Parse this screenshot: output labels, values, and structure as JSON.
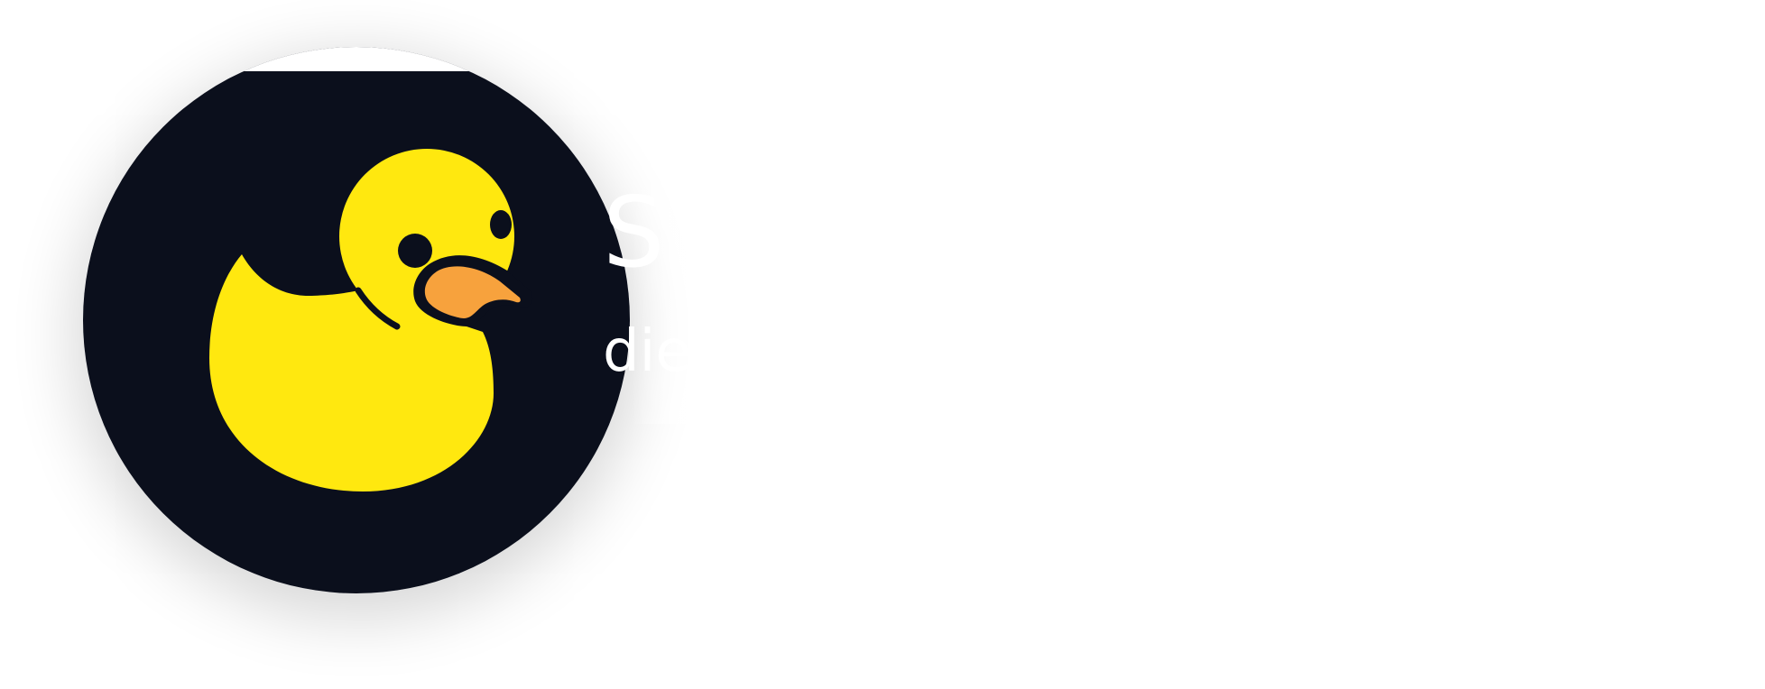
{
  "logo": {
    "icon": "rubber-duck-icon",
    "colors": {
      "background": "#0b0f1c",
      "duck_body": "#ffe80f",
      "beak": "#f7a23d",
      "outline": "#0b0f1c",
      "page": "#ffffff"
    }
  },
  "text": {
    "title": "S",
    "subtitle": "die"
  }
}
